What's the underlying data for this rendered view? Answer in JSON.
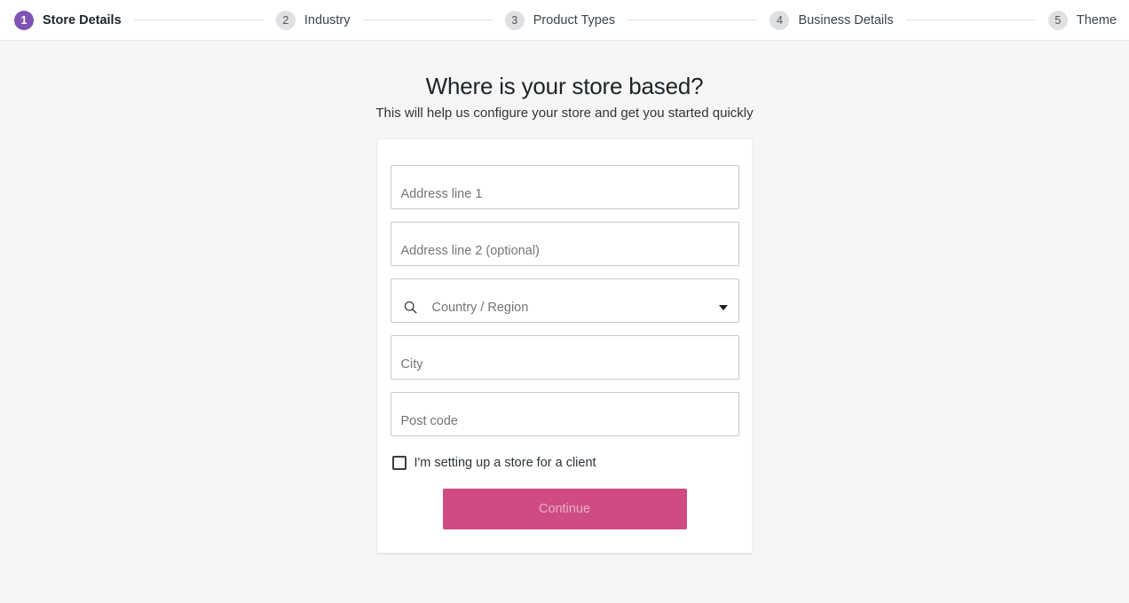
{
  "stepper": {
    "steps": [
      {
        "number": "1",
        "label": "Store Details",
        "active": true
      },
      {
        "number": "2",
        "label": "Industry",
        "active": false
      },
      {
        "number": "3",
        "label": "Product Types",
        "active": false
      },
      {
        "number": "4",
        "label": "Business Details",
        "active": false
      },
      {
        "number": "5",
        "label": "Theme",
        "active": false
      }
    ],
    "active_color": "#7f54b3",
    "inactive_color": "#e0e0e0"
  },
  "page": {
    "headline": "Where is your store based?",
    "subhead": "This will help us configure your store and get you started quickly"
  },
  "form": {
    "address_line_1": {
      "placeholder": "Address line 1",
      "value": ""
    },
    "address_line_2": {
      "placeholder": "Address line 2 (optional)",
      "value": ""
    },
    "country_region": {
      "placeholder": "Country / Region",
      "value": "",
      "search_icon": "search-icon",
      "caret_icon": "chevron-down-icon"
    },
    "city": {
      "placeholder": "City",
      "value": ""
    },
    "post_code": {
      "placeholder": "Post code",
      "value": ""
    },
    "client_checkbox": {
      "label": "I'm setting up a store for a client",
      "checked": false
    },
    "continue_button": {
      "label": "Continue",
      "color": "#cf4b84",
      "disabled": true
    }
  }
}
